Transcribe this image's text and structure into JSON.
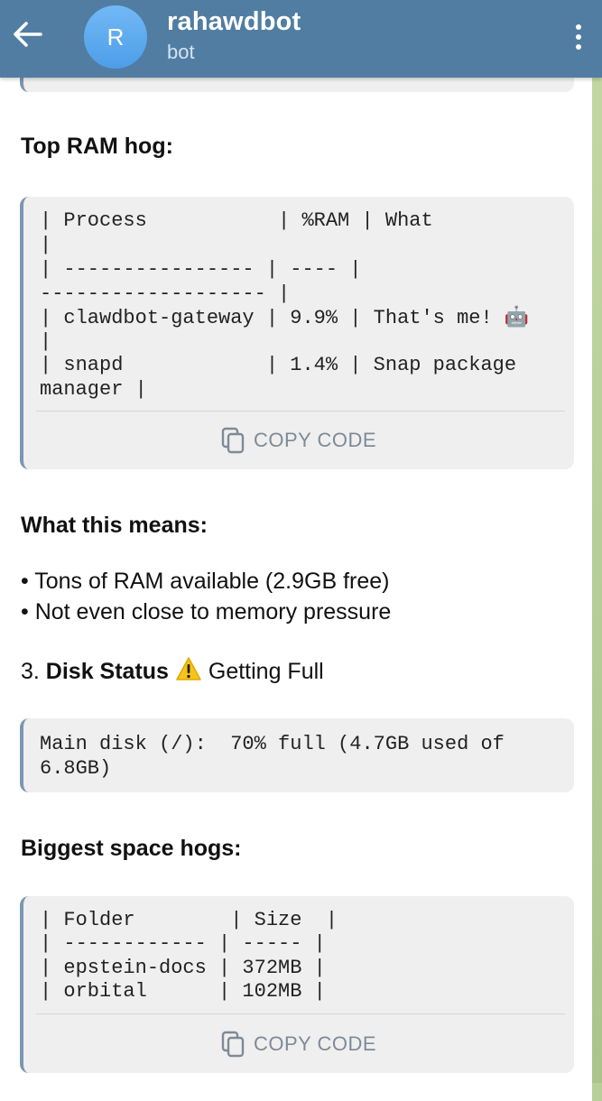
{
  "header": {
    "avatar_letter": "R",
    "title": "rahawdbot",
    "subtitle": "bot",
    "accent_color": "#517da2"
  },
  "message": {
    "ram_heading": "Top RAM hog:",
    "ram_table": [
      "| Process           | %RAM | What",
      "|",
      "| ---------------- | ---- |",
      "------------------- |",
      "| clawdbot-gateway | 9.9% | That's me! 🤖",
      "|",
      "| snapd            | 1.4% | Snap package",
      "manager |"
    ],
    "copy_label": "COPY CODE",
    "meaning_heading": "What this means:",
    "bullets": [
      "• Tons of RAM available (2.9GB free)",
      "• Not even close to memory pressure"
    ],
    "disk_prefix": "3. ",
    "disk_title": "Disk Status",
    "disk_suffix": " Getting Full",
    "disk_code": [
      "Main disk (/):  70% full (4.7GB used of",
      "6.8GB)"
    ],
    "space_heading": "Biggest space hogs:",
    "space_table": [
      "| Folder        | Size  |",
      "| ------------ | ----- |",
      "| epstein-docs | 372MB |",
      "| orbital      | 102MB |"
    ],
    "copy_label_2": "COPY CODE"
  }
}
